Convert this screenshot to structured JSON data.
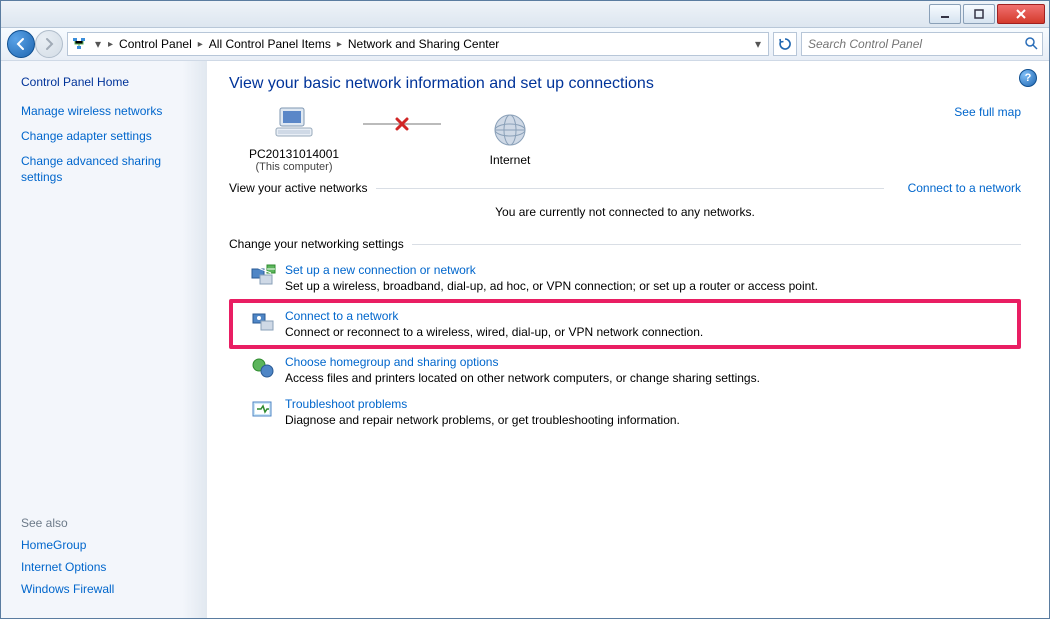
{
  "breadcrumb": {
    "root": "Control Panel",
    "mid": "All Control Panel Items",
    "leaf": "Network and Sharing Center"
  },
  "search": {
    "placeholder": "Search Control Panel"
  },
  "sidebar": {
    "home": "Control Panel Home",
    "tasks": [
      "Manage wireless networks",
      "Change adapter settings",
      "Change advanced sharing settings"
    ],
    "seealso_head": "See also",
    "seealso": [
      "HomeGroup",
      "Internet Options",
      "Windows Firewall"
    ]
  },
  "page": {
    "title": "View your basic network information and set up connections",
    "full_map": "See full map",
    "map": {
      "pc_name": "PC20131014001",
      "pc_sub": "(This computer)",
      "internet": "Internet"
    },
    "active_head": "View your active networks",
    "active_link": "Connect to a network",
    "not_connected": "You are currently not connected to any networks.",
    "change_head": "Change your networking settings",
    "settings": [
      {
        "title": "Set up a new connection or network",
        "desc": "Set up a wireless, broadband, dial-up, ad hoc, or VPN connection; or set up a router or access point."
      },
      {
        "title": "Connect to a network",
        "desc": "Connect or reconnect to a wireless, wired, dial-up, or VPN network connection."
      },
      {
        "title": "Choose homegroup and sharing options",
        "desc": "Access files and printers located on other network computers, or change sharing settings."
      },
      {
        "title": "Troubleshoot problems",
        "desc": "Diagnose and repair network problems, or get troubleshooting information."
      }
    ]
  }
}
